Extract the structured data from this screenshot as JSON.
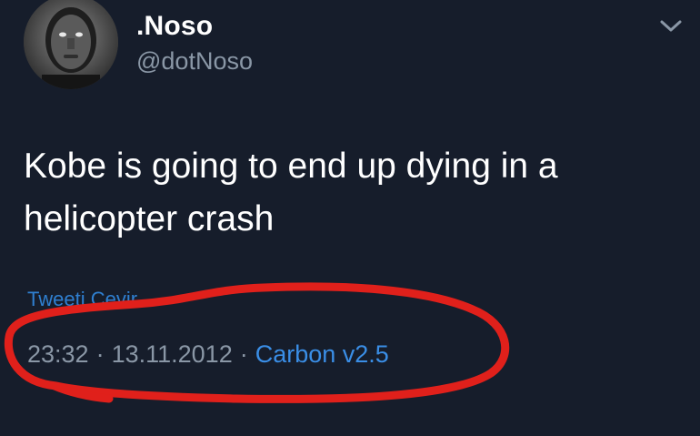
{
  "user": {
    "display_name": ".Noso",
    "handle": "@dotNoso"
  },
  "menu_icon": "chevron-down-icon",
  "tweet": {
    "text": "Kobe is going to end up dying in a helicopter crash",
    "translate_label": "Tweeti Çevir",
    "time": "23:32",
    "separator": "·",
    "date": "13.11.2012",
    "source": "Carbon v2.5"
  },
  "colors": {
    "background": "#161d2b",
    "link": "#3a8ee6",
    "annotation": "#e0201b"
  }
}
